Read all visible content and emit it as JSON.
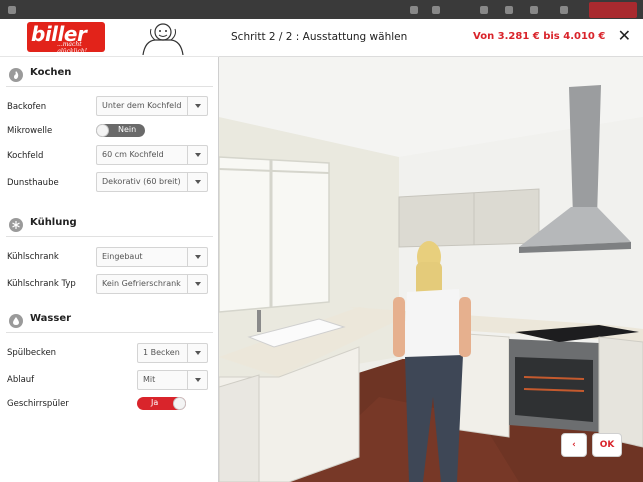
{
  "header": {
    "logo_word": "biller",
    "logo_tagline": "...macht glücklich!",
    "step_title": "Schritt 2 / 2 : Ausstattung wählen",
    "price_range": "Von 3.281 € bis 4.010 €",
    "close_label": "✕"
  },
  "sections": {
    "kochen": {
      "title": "Kochen",
      "rows": {
        "backofen": {
          "label": "Backofen",
          "value": "Unter dem Kochfeld"
        },
        "mikrowelle": {
          "label": "Mikrowelle",
          "value": "Nein"
        },
        "kochfeld": {
          "label": "Kochfeld",
          "value": "60 cm Kochfeld"
        },
        "dunsthaube": {
          "label": "Dunsthaube",
          "value": "Dekorativ (60 breit)"
        }
      }
    },
    "kuehlung": {
      "title": "Kühlung",
      "rows": {
        "kuehlschrank": {
          "label": "Kühlschrank",
          "value": "Eingebaut"
        },
        "kuehlschrank_typ": {
          "label": "Kühlschrank Typ",
          "value": "Kein Gefrierschrank"
        }
      }
    },
    "wasser": {
      "title": "Wasser",
      "rows": {
        "spuelbecken": {
          "label": "Spülbecken",
          "value": "1 Becken"
        },
        "ablauf": {
          "label": "Ablauf",
          "value": "Mit"
        },
        "geschirrspueler": {
          "label": "Geschirrspüler",
          "value": "Ja"
        }
      }
    }
  },
  "navigation": {
    "back_label": "‹",
    "ok_label": "OK"
  },
  "colors": {
    "brand_red": "#d9242b",
    "toggle_off": "#6a6a6a"
  }
}
